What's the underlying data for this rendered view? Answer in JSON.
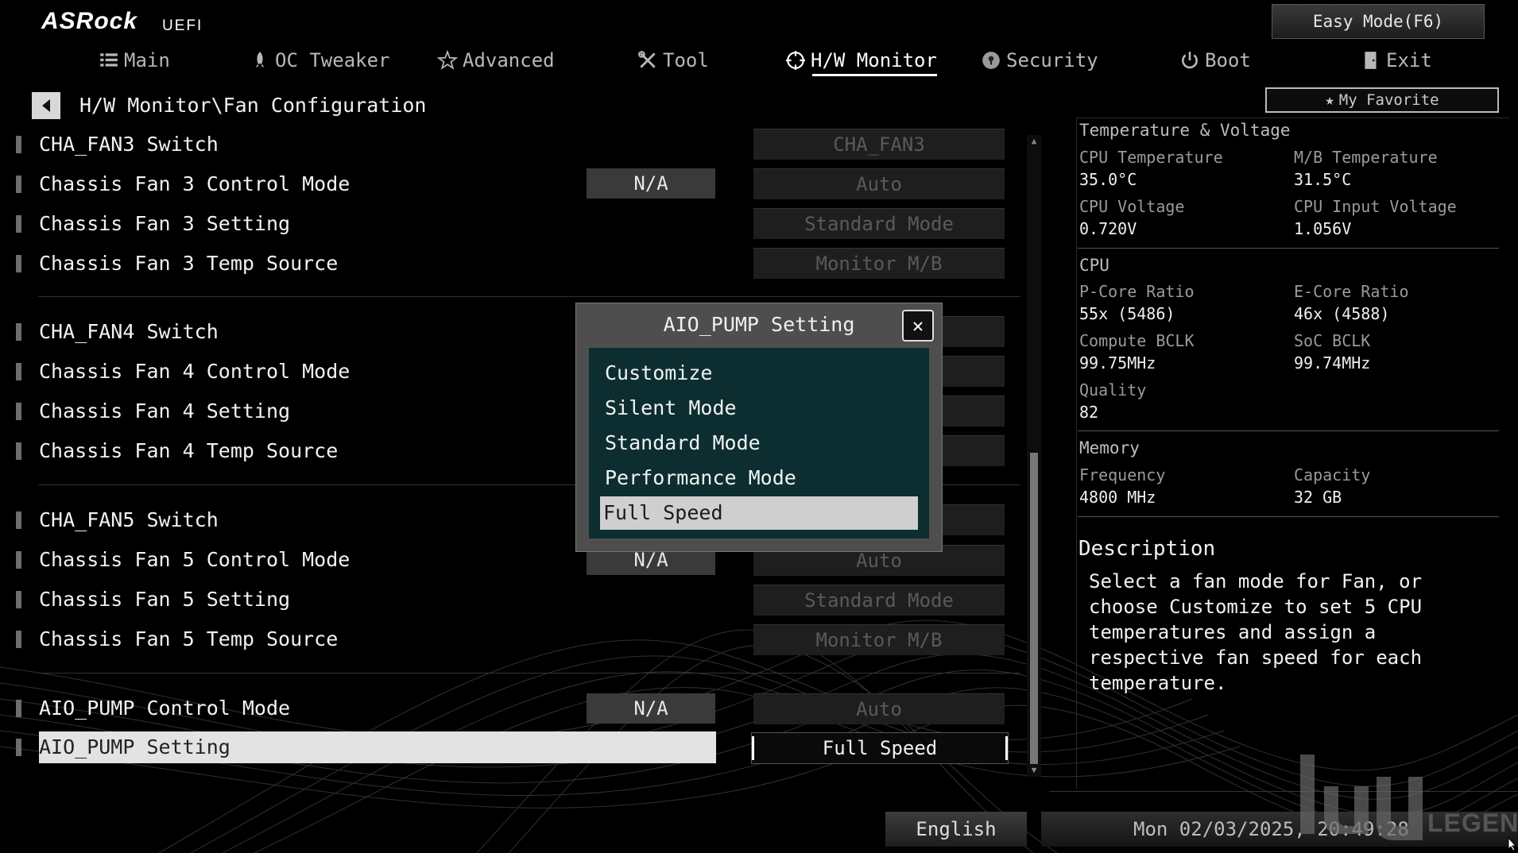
{
  "header": {
    "logo": "ASRock",
    "logo_sub": "UEFI",
    "easy_mode": "Easy Mode(F6)",
    "tabs": [
      {
        "label": "Main",
        "icon": "list-icon"
      },
      {
        "label": "OC Tweaker",
        "icon": "rocket-icon"
      },
      {
        "label": "Advanced",
        "icon": "star-icon"
      },
      {
        "label": "Tool",
        "icon": "tools-icon"
      },
      {
        "label": "H/W Monitor",
        "icon": "monitor-target-icon",
        "active": true
      },
      {
        "label": "Security",
        "icon": "shield-icon"
      },
      {
        "label": "Boot",
        "icon": "power-icon"
      },
      {
        "label": "Exit",
        "icon": "exit-door-icon"
      }
    ],
    "breadcrumb": "H/W Monitor\\Fan Configuration",
    "favorite": "My Favorite"
  },
  "settings": [
    {
      "label": "CHA_FAN3 Switch",
      "na": "",
      "value": "CHA_FAN3"
    },
    {
      "label": "Chassis Fan 3 Control Mode",
      "na": "N/A",
      "value": "Auto"
    },
    {
      "label": "Chassis Fan 3 Setting",
      "na": "",
      "value": "Standard Mode"
    },
    {
      "label": "Chassis Fan 3 Temp Source",
      "na": "",
      "value": "Monitor M/B"
    },
    {
      "label": "CHA_FAN4 Switch",
      "na": "",
      "value": ""
    },
    {
      "label": "Chassis Fan 4 Control Mode",
      "na": "",
      "value": ""
    },
    {
      "label": "Chassis Fan 4 Setting",
      "na": "",
      "value": ""
    },
    {
      "label": "Chassis Fan 4 Temp Source",
      "na": "",
      "value": ""
    },
    {
      "label": "CHA_FAN5 Switch",
      "na": "",
      "value": ""
    },
    {
      "label": "Chassis Fan 5 Control Mode",
      "na": "N/A",
      "value": "Auto"
    },
    {
      "label": "Chassis Fan 5 Setting",
      "na": "",
      "value": "Standard Mode"
    },
    {
      "label": "Chassis Fan 5 Temp Source",
      "na": "",
      "value": "Monitor M/B"
    },
    {
      "label": "AIO_PUMP Control Mode",
      "na": "N/A",
      "value": "Auto"
    },
    {
      "label": "AIO_PUMP Setting",
      "na": "",
      "value": "Full Speed",
      "selected": true
    }
  ],
  "modal": {
    "title": "AIO_PUMP Setting",
    "options": [
      "Customize",
      "Silent Mode",
      "Standard Mode",
      "Performance Mode",
      "Full Speed"
    ],
    "selected": "Full Speed"
  },
  "panel": {
    "temp_voltage": {
      "heading": "Temperature & Voltage",
      "cpu_temp_label": "CPU Temperature",
      "cpu_temp": "35.0°C",
      "mb_temp_label": "M/B Temperature",
      "mb_temp": "31.5°C",
      "cpu_volt_label": "CPU Voltage",
      "cpu_volt": "0.720V",
      "cpu_in_volt_label": "CPU Input Voltage",
      "cpu_in_volt": "1.056V"
    },
    "cpu": {
      "heading": "CPU",
      "pcore_label": "P-Core Ratio",
      "pcore": "55x (5486)",
      "ecore_label": "E-Core Ratio",
      "ecore": "46x (4588)",
      "bclk_label": "Compute BCLK",
      "bclk": "99.75MHz",
      "soc_label": "SoC BCLK",
      "soc": "99.74MHz",
      "quality_label": "Quality",
      "quality": "82"
    },
    "memory": {
      "heading": "Memory",
      "freq_label": "Frequency",
      "freq": "4800 MHz",
      "cap_label": "Capacity",
      "cap": "32 GB"
    },
    "description": {
      "heading": "Description",
      "text": "Select a fan mode for Fan, or choose Customize to set 5 CPU temperatures and assign a respective fan speed for each temperature."
    }
  },
  "footer": {
    "language": "English",
    "datetime": "Mon 02/03/2025, 20:49:28",
    "watermark": "LEGEND"
  }
}
